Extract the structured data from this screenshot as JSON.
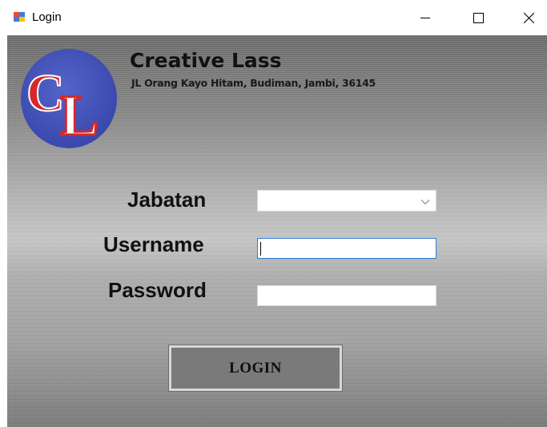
{
  "window": {
    "title": "Login",
    "controls": {
      "minimize": "minimize-icon",
      "maximize": "maximize-icon",
      "close": "close-icon"
    }
  },
  "header": {
    "logo_letters": "CL",
    "company_name": "Creative Lass",
    "address": "JL Orang Kayo Hitam, Budiman, Jambi, 36145"
  },
  "form": {
    "jabatan_label": "Jabatan",
    "jabatan_value": "",
    "username_label": "Username",
    "username_value": "",
    "password_label": "Password",
    "password_value": "",
    "login_label": "LOGIN"
  },
  "colors": {
    "logo_circle": "#3f4fb8",
    "logo_letters": "#d62828",
    "logo_letters_fill": "#ffffff",
    "focus_border": "#2a7bd4"
  }
}
